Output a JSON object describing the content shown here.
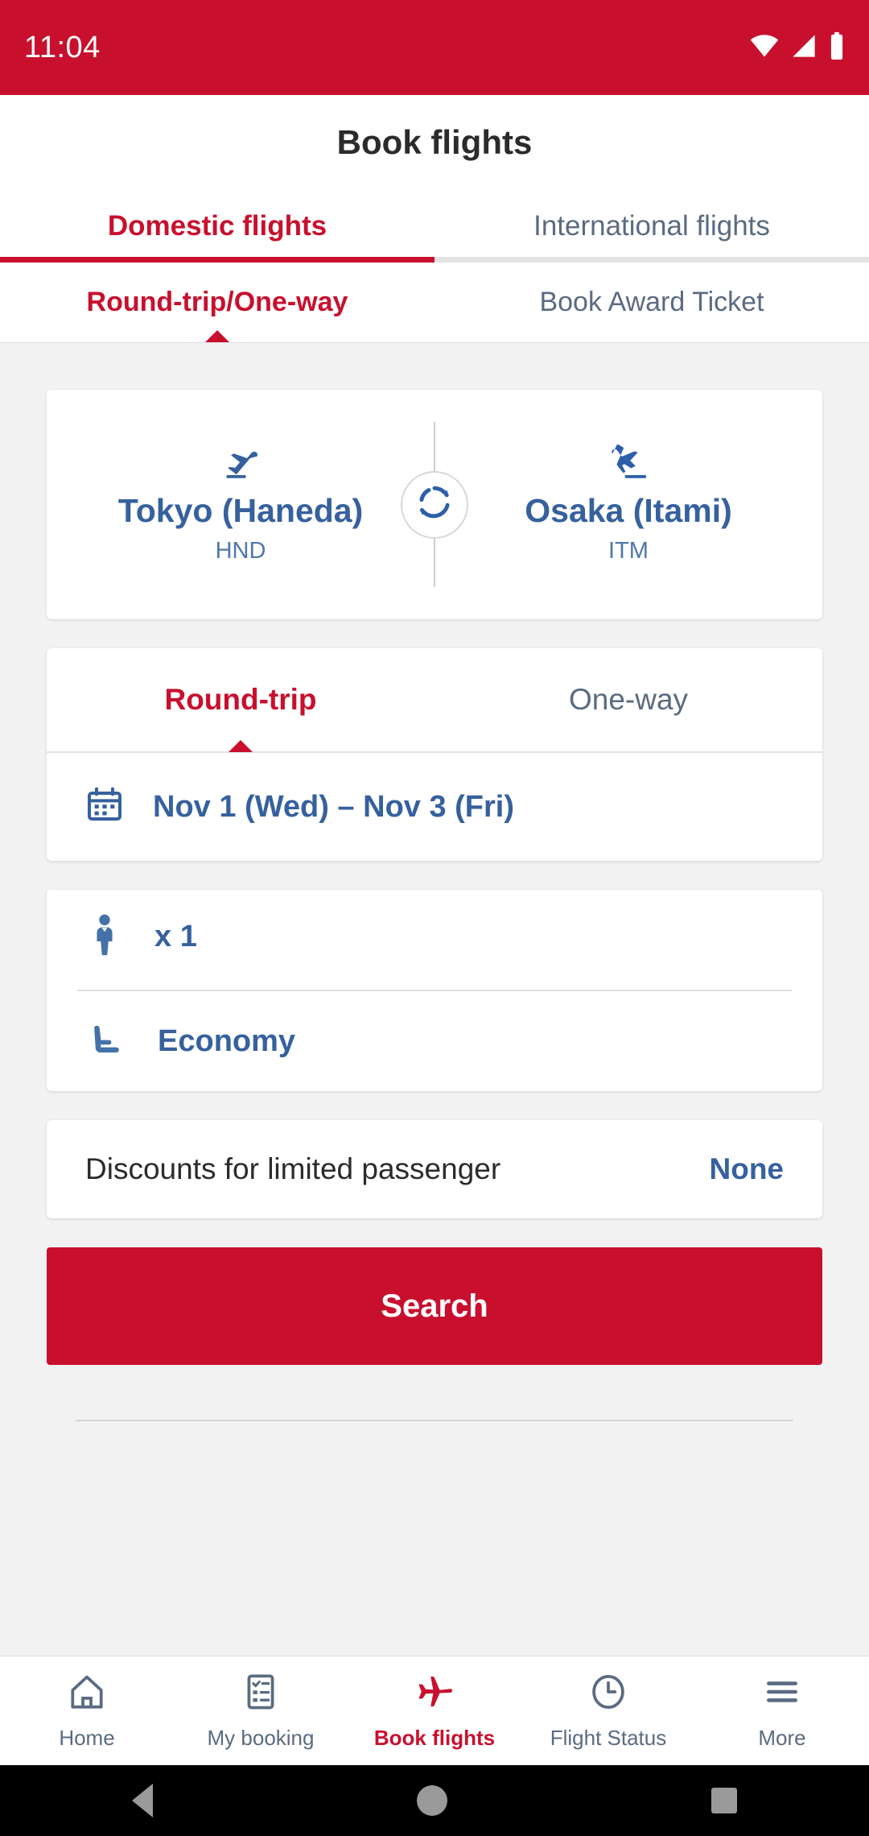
{
  "status_bar": {
    "time": "11:04",
    "icons": [
      "wifi-icon",
      "cellular-signal-icon",
      "battery-icon"
    ],
    "background_color": "#c8102e"
  },
  "header": {
    "title": "Book flights"
  },
  "primary_tabs": [
    {
      "label": "Domestic flights",
      "active": true
    },
    {
      "label": "International flights",
      "active": false
    }
  ],
  "secondary_tabs": [
    {
      "label": "Round-trip/One-way",
      "active": true
    },
    {
      "label": "Book Award Ticket",
      "active": false
    }
  ],
  "route": {
    "origin": {
      "city": "Tokyo (Haneda)",
      "code": "HND",
      "icon": "flight-takeoff-icon"
    },
    "destination": {
      "city": "Osaka (Itami)",
      "code": "ITM",
      "icon": "flight-landing-icon"
    },
    "swap_icon": "swap-circular-arrows-icon"
  },
  "trip_type": {
    "options": [
      {
        "label": "Round-trip",
        "active": true
      },
      {
        "label": "One-way",
        "active": false
      }
    ]
  },
  "dates": {
    "icon": "calendar-icon",
    "value": "Nov 1 (Wed) – Nov 3 (Fri)"
  },
  "passengers": {
    "icon": "person-icon",
    "value": "x 1"
  },
  "cabin_class": {
    "icon": "airline-seat-icon",
    "value": "Economy"
  },
  "discount": {
    "label": "Discounts for limited passenger",
    "value": "None"
  },
  "search_button": {
    "label": "Search"
  },
  "bottom_nav": [
    {
      "label": "Home",
      "icon": "home-icon",
      "active": false
    },
    {
      "label": "My booking",
      "icon": "clipboard-checklist-icon",
      "active": false
    },
    {
      "label": "Book flights",
      "icon": "airplane-icon",
      "active": true
    },
    {
      "label": "Flight Status",
      "icon": "clock-icon",
      "active": false
    },
    {
      "label": "More",
      "icon": "hamburger-menu-icon",
      "active": false
    }
  ],
  "system_nav": {
    "back": "back-triangle-icon",
    "home": "home-circle-icon",
    "recents": "recents-square-icon"
  },
  "colors": {
    "brand_red": "#c8102e",
    "link_blue": "#36619e",
    "muted_slate": "#5a6b82",
    "page_bg": "#f2f2f2"
  }
}
